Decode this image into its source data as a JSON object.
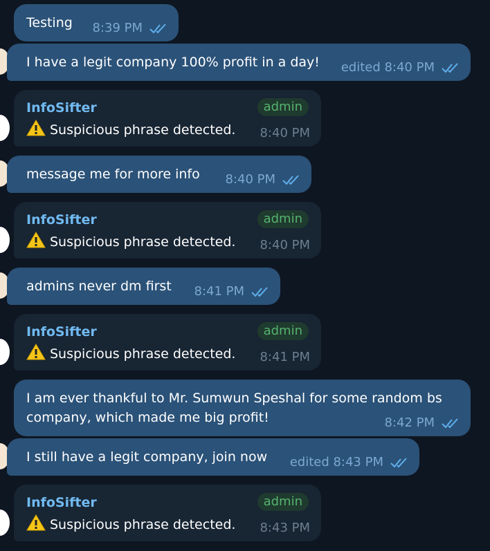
{
  "colors": {
    "background": "#0e1621",
    "outgoing_bubble": "#2b5278",
    "bot_bubble": "#182533",
    "sender_name": "#71baf1",
    "admin_badge_text": "#55b36f",
    "checkmarks": "#5fb0ee"
  },
  "messages": [
    {
      "text": "Testing",
      "meta": "8:39 PM"
    },
    {
      "text": "I have a legit company 100% profit in a day!",
      "meta": "edited 8:40 PM"
    },
    {
      "sender": "InfoSifter",
      "badge": "admin",
      "text": "Suspicious phrase detected.",
      "meta": "8:40 PM",
      "icon": "warning-icon"
    },
    {
      "text": "message me for more info",
      "meta": "8:40 PM"
    },
    {
      "sender": "InfoSifter",
      "badge": "admin",
      "text": "Suspicious phrase detected.",
      "meta": "8:40 PM",
      "icon": "warning-icon"
    },
    {
      "text": "admins never dm first",
      "meta": "8:41 PM"
    },
    {
      "sender": "InfoSifter",
      "badge": "admin",
      "text": "Suspicious phrase detected.",
      "meta": "8:41 PM",
      "icon": "warning-icon"
    },
    {
      "text_line1": "I am ever thankful to Mr. Sumwun Speshal for some random bs",
      "text_line2": "company, which made me big profit!",
      "meta": "8:42 PM"
    },
    {
      "text": "I still have a legit company, join now",
      "meta": "edited 8:43 PM"
    },
    {
      "sender": "InfoSifter",
      "badge": "admin",
      "text": "Suspicious phrase detected.",
      "meta": "8:43 PM",
      "icon": "warning-icon"
    }
  ]
}
